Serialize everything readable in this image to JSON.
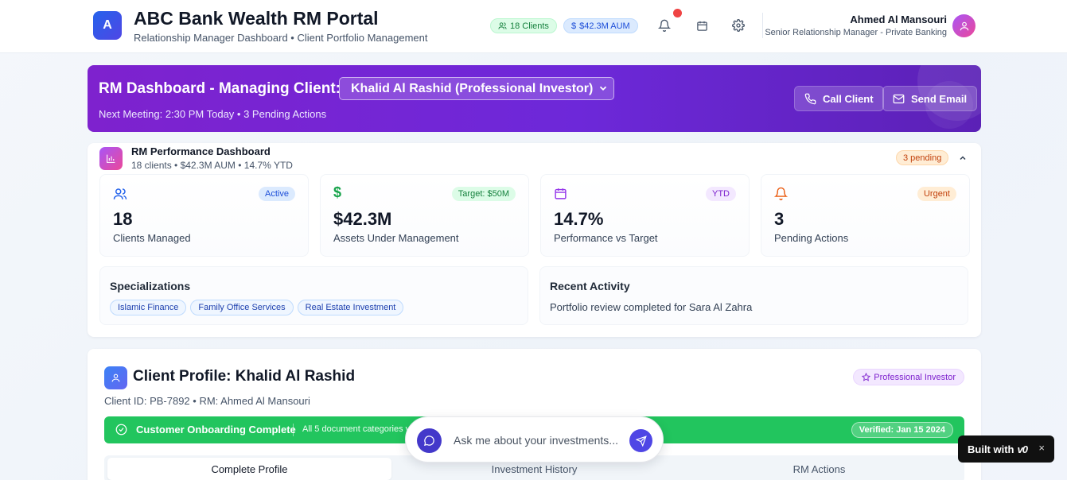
{
  "header": {
    "logo_letter": "A",
    "title": "ABC Bank Wealth RM Portal",
    "subtitle": "Relationship Manager Dashboard • Client Portfolio Management",
    "clients_chip": "18 Clients",
    "aum_chip": "$42.3M AUM",
    "user_name": "Ahmed Al Mansouri",
    "user_role": "Senior Relationship Manager - Private Banking",
    "icons": [
      "users-icon",
      "dollar-icon",
      "bell-icon",
      "calendar-icon",
      "gear-icon",
      "user-icon"
    ]
  },
  "banner": {
    "title": "RM Dashboard - Managing Client:",
    "selected_client": "Khalid Al Rashid (Professional Investor)",
    "subtitle": "Next Meeting: 2:30 PM Today • 3 Pending Actions",
    "call_label": "Call Client",
    "email_label": "Send Email"
  },
  "performance": {
    "title": "RM Performance Dashboard",
    "subtitle": "18 clients • $42.3M AUM • 14.7% YTD",
    "pending_badge": "3 pending",
    "stats": [
      {
        "value": "18",
        "label": "Clients Managed",
        "badge": "Active"
      },
      {
        "value": "$42.3M",
        "label": "Assets Under Management",
        "badge": "Target: $50M"
      },
      {
        "value": "14.7%",
        "label": "Performance vs Target",
        "badge": "YTD"
      },
      {
        "value": "3",
        "label": "Pending Actions",
        "badge": "Urgent"
      }
    ],
    "specializations_title": "Specializations",
    "specializations": [
      "Islamic Finance",
      "Family Office Services",
      "Real Estate Investment"
    ],
    "recent_title": "Recent Activity",
    "recent_text": "Portfolio review completed for Sara Al Zahra"
  },
  "profile": {
    "title": "Client Profile: Khalid Al Rashid",
    "subtitle": "Client ID: PB-7892 • RM: Ahmed Al Mansouri",
    "badge": "Professional Investor",
    "onboarding_title": "Customer Onboarding Complete",
    "onboarding_detail": "All 5 document categories v",
    "verified": "Verified: Jan 15 2024",
    "tabs": [
      "Complete Profile",
      "Investment History",
      "RM Actions"
    ]
  },
  "chat": {
    "placeholder": "Ask me about your investments..."
  },
  "built_with": {
    "label": "Built with",
    "brand": "v0",
    "close": "×"
  },
  "colors": {
    "banner": "#6d28d9",
    "accent": "#4f46e5",
    "success": "#22c55e",
    "pending": "#c2410c"
  }
}
